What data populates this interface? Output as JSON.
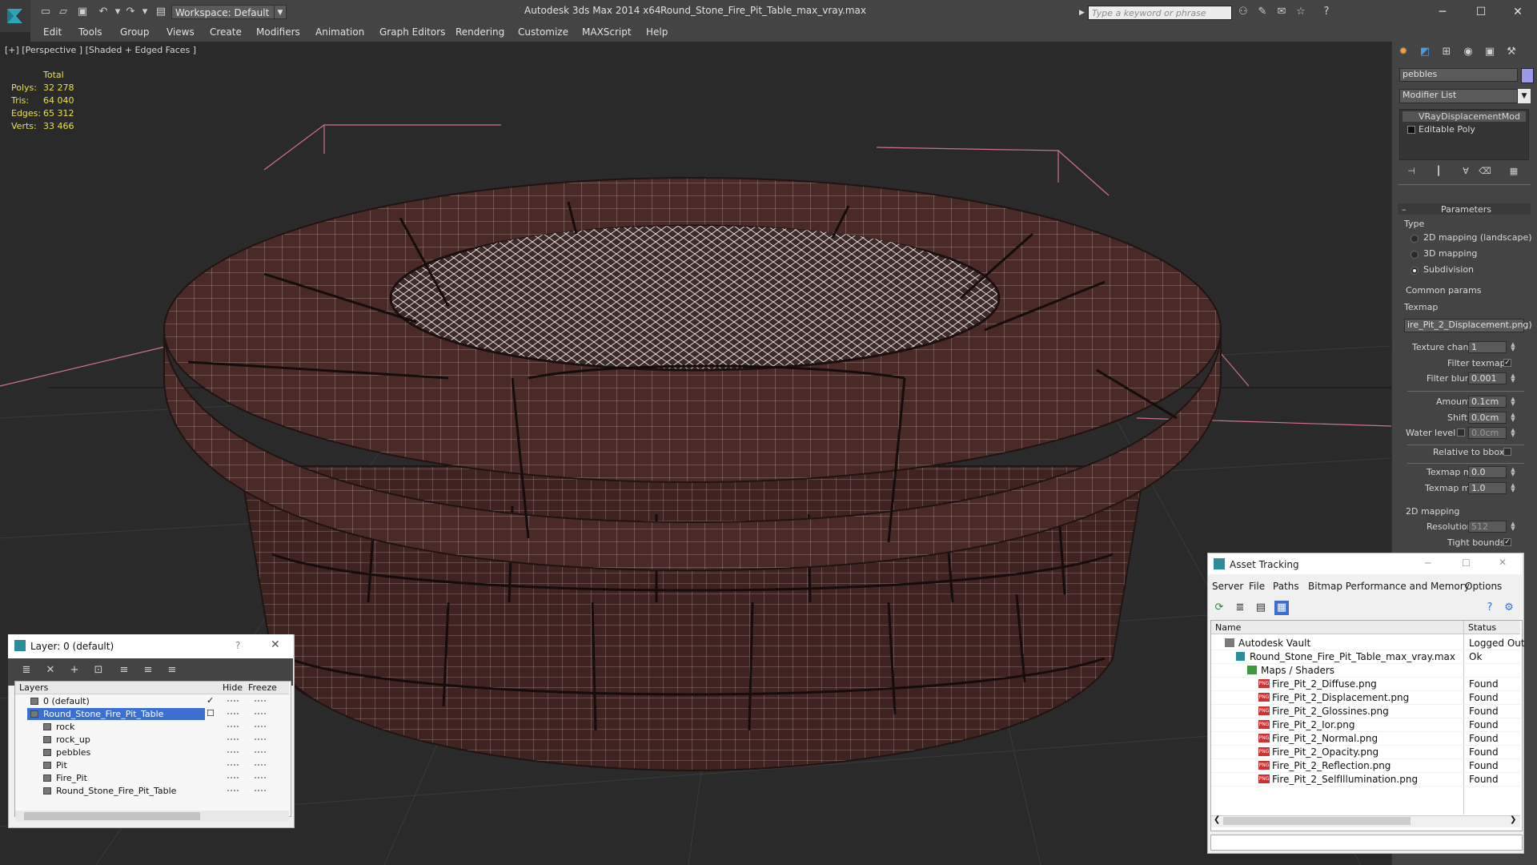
{
  "app": {
    "title": "Autodesk 3ds Max  2014 x64",
    "file": "Round_Stone_Fire_Pit_Table_max_vray.max",
    "workspace": "Workspace: Default",
    "search_placeholder": "Type a keyword or phrase"
  },
  "menu": [
    "Edit",
    "Tools",
    "Group",
    "Views",
    "Create",
    "Modifiers",
    "Animation",
    "Graph Editors",
    "Rendering",
    "Customize",
    "MAXScript",
    "Help"
  ],
  "viewport": {
    "label": "[+] [Perspective ] [Shaded + Edged Faces ]",
    "stats_header": "Total",
    "stats": [
      {
        "label": "Polys:",
        "value": "32 278"
      },
      {
        "label": "Tris:",
        "value": "64 040"
      },
      {
        "label": "Edges:",
        "value": "65 312"
      },
      {
        "label": "Verts:",
        "value": "33 466"
      }
    ]
  },
  "command_panel": {
    "object_name": "pebbles",
    "modifier_list": "Modifier List",
    "stack": [
      "VRayDisplacementMod",
      "Editable Poly"
    ],
    "rollout_title": "Parameters",
    "type_group": "Type",
    "type_options": [
      {
        "label": "2D mapping (landscape)",
        "selected": false
      },
      {
        "label": "3D mapping",
        "selected": false
      },
      {
        "label": "Subdivision",
        "selected": true
      }
    ],
    "common_group": "Common params",
    "texmap_label": "Texmap",
    "texmap_value": "ire_Pit_2_Displacement.png)",
    "texture_chan_label": "Texture chan",
    "texture_chan_value": "1",
    "filter_texmap_label": "Filter texmap",
    "filter_blur_label": "Filter blur",
    "filter_blur_value": "0.001",
    "amount_label": "Amount",
    "amount_value": "0.1cm",
    "shift_label": "Shift",
    "shift_value": "0.0cm",
    "water_level_label": "Water level",
    "water_level_value": "0.0cm",
    "relative_bbox_label": "Relative to bbox",
    "texmap_min_label": "Texmap min",
    "texmap_min_value": "0.0",
    "texmap_max_label": "Texmap max",
    "texmap_max_value": "1.0",
    "mapping2d_group": "2D mapping",
    "resolution_label": "Resolution",
    "resolution_value": "512",
    "tight_bounds_label": "Tight bounds"
  },
  "layer_dialog": {
    "title": "Layer: 0 (default)",
    "help": "?",
    "col_layers": "Layers",
    "col_hide": "Hide",
    "col_freeze": "Freeze",
    "rows": [
      {
        "name": "0 (default)",
        "level": 0,
        "selected": false,
        "checked": true
      },
      {
        "name": "Round_Stone_Fire_Pit_Table",
        "level": 0,
        "selected": true,
        "checked": false
      },
      {
        "name": "rock",
        "level": 1,
        "selected": false,
        "checked": false
      },
      {
        "name": "rock_up",
        "level": 1,
        "selected": false,
        "checked": false
      },
      {
        "name": "pebbles",
        "level": 1,
        "selected": false,
        "checked": false
      },
      {
        "name": "Pit",
        "level": 1,
        "selected": false,
        "checked": false
      },
      {
        "name": "Fire_Pit",
        "level": 1,
        "selected": false,
        "checked": false
      },
      {
        "name": "Round_Stone_Fire_Pit_Table",
        "level": 1,
        "selected": false,
        "checked": false
      }
    ]
  },
  "asset_tracking": {
    "title": "Asset Tracking",
    "menu": [
      "Server",
      "File",
      "Paths",
      "Bitmap Performance and Memory",
      "Options"
    ],
    "col_name": "Name",
    "col_status": "Status",
    "rows": [
      {
        "name": "Autodesk Vault",
        "status": "Logged Out",
        "level": 0,
        "icon": "vault"
      },
      {
        "name": "Round_Stone_Fire_Pit_Table_max_vray.max",
        "status": "Ok",
        "level": 1,
        "icon": "max"
      },
      {
        "name": "Maps / Shaders",
        "status": "",
        "level": 2,
        "icon": "maps"
      },
      {
        "name": "Fire_Pit_2_Diffuse.png",
        "status": "Found",
        "level": 3,
        "icon": "png"
      },
      {
        "name": "Fire_Pit_2_Displacement.png",
        "status": "Found",
        "level": 3,
        "icon": "png"
      },
      {
        "name": "Fire_Pit_2_Glossines.png",
        "status": "Found",
        "level": 3,
        "icon": "png"
      },
      {
        "name": "Fire_Pit_2_Ior.png",
        "status": "Found",
        "level": 3,
        "icon": "png"
      },
      {
        "name": "Fire_Pit_2_Normal.png",
        "status": "Found",
        "level": 3,
        "icon": "png"
      },
      {
        "name": "Fire_Pit_2_Opacity.png",
        "status": "Found",
        "level": 3,
        "icon": "png"
      },
      {
        "name": "Fire_Pit_2_Reflection.png",
        "status": "Found",
        "level": 3,
        "icon": "png"
      },
      {
        "name": "Fire_Pit_2_SelfIllumination.png",
        "status": "Found",
        "level": 3,
        "icon": "png"
      }
    ]
  },
  "colors": {
    "ui_dark": "#444444",
    "viewport_bg": "#2a2a2a",
    "stats_yellow": "#e8e04a",
    "layer_selected": "#3c6fd1",
    "stone": "#4a2a26"
  }
}
